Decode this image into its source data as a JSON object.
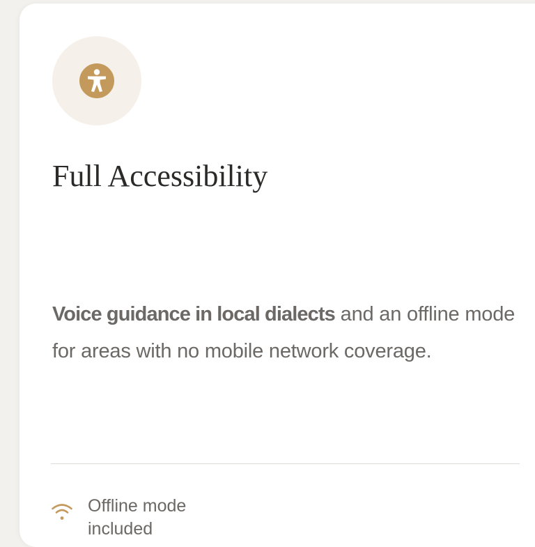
{
  "card": {
    "icon": "accessibility-icon",
    "title": "Full Accessibility",
    "description": {
      "highlight": "Voice guidance in local dialects",
      "rest": " and an offline mode for areas with no mobile network coverage."
    },
    "footer": {
      "icon": "wifi-icon",
      "text": "Offline mode included"
    }
  },
  "colors": {
    "accent": "#c49a5c",
    "icon_bg": "#f5f0ea",
    "title": "#2b2a28",
    "body_text": "#6b6865",
    "divider": "#dedbd6",
    "page_bg": "#f3f1ed",
    "card_bg": "#ffffff"
  }
}
